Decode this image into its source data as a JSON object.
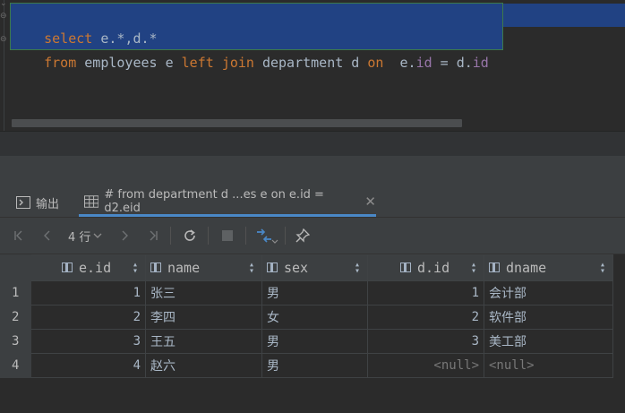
{
  "editor": {
    "line1": {
      "kw": "select",
      "rest": " e.*,d.*"
    },
    "line2": {
      "kw1": "from",
      "t1": " employees e ",
      "kw2": "left",
      "sp1": " ",
      "kw3": "join",
      "t2": " department d ",
      "kw4": "on",
      "t3": "  e.",
      "f1": "id",
      "t4": " = d.",
      "f2": "id"
    }
  },
  "tabs": {
    "output": {
      "label": "输出",
      "icon": "console-icon"
    },
    "result": {
      "label": "# from department d ...es e on e.id = d2.eid",
      "icon": "table-icon",
      "close": "✕"
    }
  },
  "toolbar": {
    "rows_label": "4 行",
    "buttons": [
      "first-page",
      "previous-page",
      "next-page",
      "last-page",
      "reload",
      "stop",
      "compare",
      "pin"
    ]
  },
  "grid": {
    "columns": [
      "e.id",
      "name",
      "sex",
      "d.id",
      "dname"
    ],
    "rows": [
      {
        "num": "1",
        "eid": "1",
        "name": "张三",
        "sex": "男",
        "did": "1",
        "dname": "会计部"
      },
      {
        "num": "2",
        "eid": "2",
        "name": "李四",
        "sex": "女",
        "did": "2",
        "dname": "软件部"
      },
      {
        "num": "3",
        "eid": "3",
        "name": "王五",
        "sex": "男",
        "did": "3",
        "dname": "美工部"
      },
      {
        "num": "4",
        "eid": "4",
        "name": "赵六",
        "sex": "男",
        "did": "<null>",
        "dname": "<null>"
      }
    ]
  },
  "colors": {
    "background": "#2b2b2b",
    "selection": "#214283",
    "keyword": "#cc7832",
    "field": "#9876aa",
    "tab_underline": "#4a88c7"
  }
}
